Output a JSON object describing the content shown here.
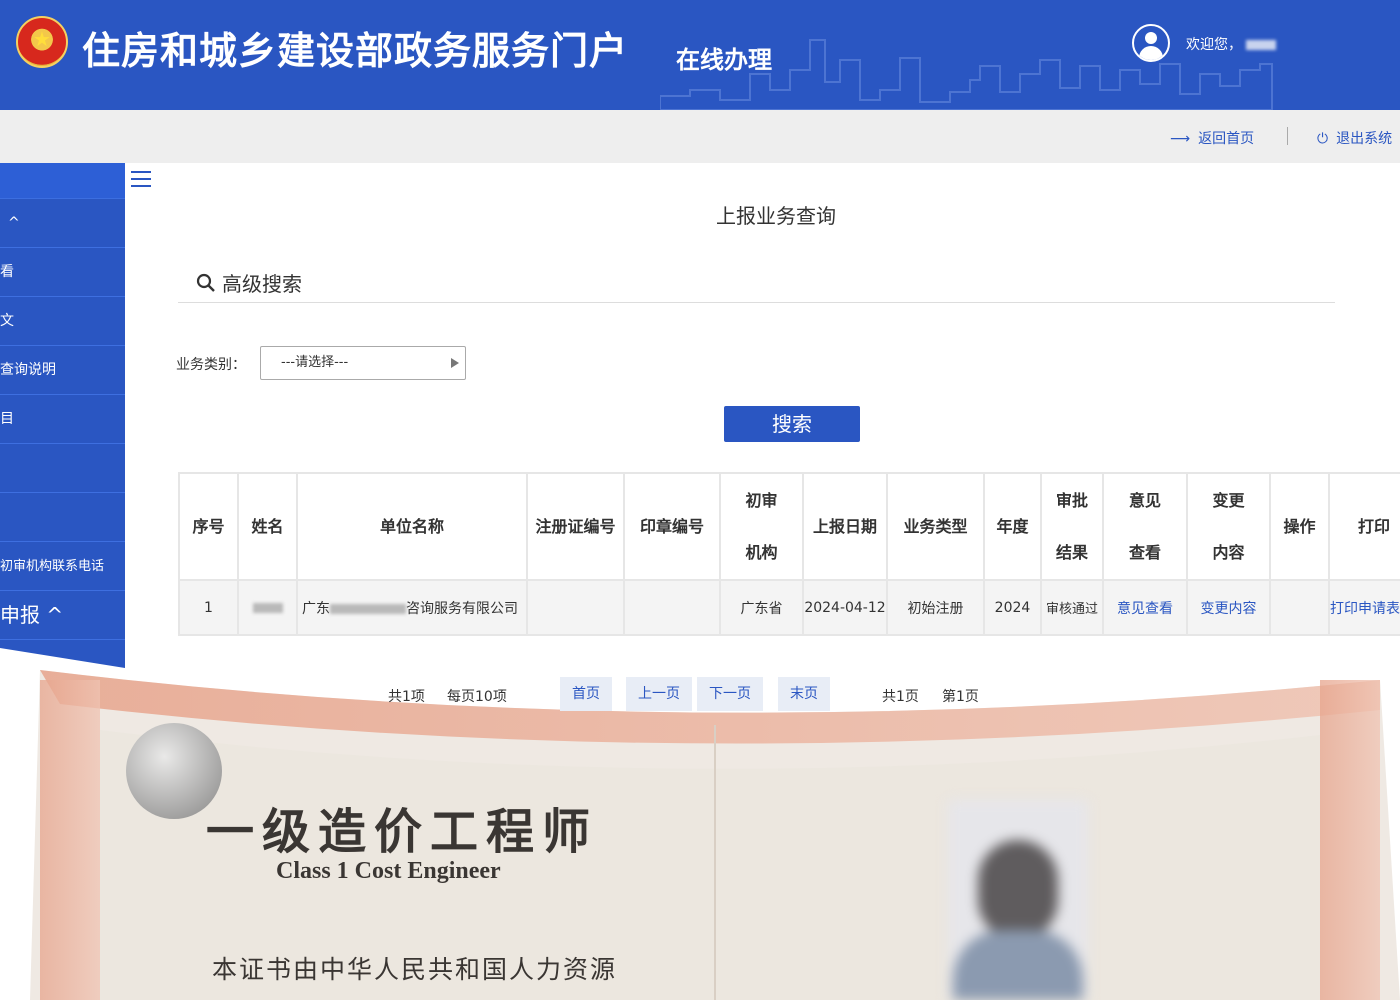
{
  "header": {
    "site_title": "住房和城乡建设部政务服务门户",
    "section_title": "在线办理",
    "welcome_text": "欢迎您，",
    "brand_color": "#2a56c2"
  },
  "subbar": {
    "home_link": "返回首页",
    "logout_link": "退出系统"
  },
  "sidebar": {
    "items": [
      {
        "label": "^"
      },
      {
        "label": "看"
      },
      {
        "label": "文"
      },
      {
        "label": "查询说明"
      },
      {
        "label": "目"
      },
      {
        "label": ""
      },
      {
        "label": ""
      },
      {
        "label": "初审机构联系电话"
      },
      {
        "label": "申报 ^"
      }
    ]
  },
  "main": {
    "page_title": "上报业务查询",
    "advanced_search_label": "高级搜索",
    "business_type_label": "业务类别：",
    "business_type_placeholder": "---请选择---",
    "search_button": "搜索"
  },
  "table": {
    "headers": [
      {
        "line1": "序号",
        "line2": ""
      },
      {
        "line1": "姓名",
        "line2": ""
      },
      {
        "line1": "单位名称",
        "line2": ""
      },
      {
        "line1": "注册证编号",
        "line2": ""
      },
      {
        "line1": "印章编号",
        "line2": ""
      },
      {
        "line1": "初审",
        "line2": "机构"
      },
      {
        "line1": "上报日期",
        "line2": ""
      },
      {
        "line1": "业务类型",
        "line2": ""
      },
      {
        "line1": "年度",
        "line2": ""
      },
      {
        "line1": "审批",
        "line2": "结果"
      },
      {
        "line1": "意见",
        "line2": "查看"
      },
      {
        "line1": "变更",
        "line2": "内容"
      },
      {
        "line1": "操作",
        "line2": ""
      },
      {
        "line1": "打印",
        "line2": ""
      }
    ],
    "rows": [
      {
        "index": "1",
        "company_prefix": "广东",
        "company_suffix": "咨询服务有限公司",
        "reg_no": "",
        "seal_no": "",
        "review_org": "广东省",
        "date": "2024-04-12",
        "business_type": "初始注册",
        "year": "2024",
        "result": "审核通过",
        "opinion": "意见查看",
        "change": "变更内容",
        "operation": "",
        "print": "打印申请表"
      }
    ]
  },
  "pagination": {
    "total": "共1项",
    "per_page": "每页10项",
    "first": "首页",
    "prev": "上一页",
    "next": "下一页",
    "last": "末页",
    "pages": "共1页",
    "current": "第1页"
  },
  "certificate": {
    "title_cn": "一级造价工程师",
    "title_en": "Class 1 Cost Engineer",
    "statement": "本证书由中华人民共和国人力资源"
  }
}
